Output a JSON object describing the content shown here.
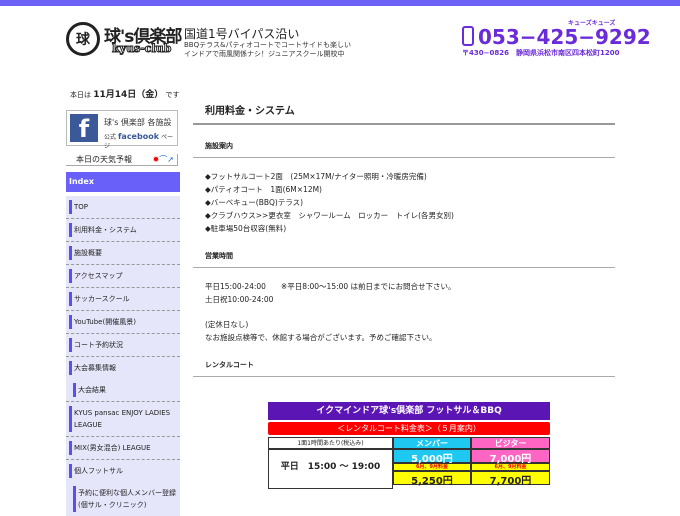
{
  "header": {
    "logo_text": "球",
    "brand": "球's倶楽部",
    "brand_sub": "kyus-club",
    "tagline": "国道1号バイパス沿い",
    "tagline_sub1": "BBQテラス&パティオコートでコートサイドも楽しい",
    "tagline_sub2": "インドアで雨風関係ナシ！ジュニアスクール開校中",
    "phone": "053−425−9292",
    "phone_kana": "キューズキューズ",
    "address": "〒430−0826　静岡県浜松市南区四本松町1200",
    "accent": "#6a2bd8"
  },
  "sidebar": {
    "date_prefix": "本日は",
    "date": "11月14日（金）",
    "date_suffix": "です",
    "facebook": {
      "line1": "球's 倶楽部 各施設",
      "line2_prefix": "公式",
      "line2_brand": "facebook",
      "line2_suffix": "ページ"
    },
    "weather": "本日の天気予報",
    "index_label": "Index",
    "items": [
      {
        "label": "TOP"
      },
      {
        "label": "利用料金・システム"
      },
      {
        "label": "施設概要"
      },
      {
        "label": "アクセスマップ"
      },
      {
        "label": "サッカースクール"
      },
      {
        "label": "YouTube(開催風景)"
      },
      {
        "label": "コート予約状況"
      },
      {
        "label": "大会募集情報"
      },
      {
        "label": "大会結果"
      },
      {
        "label": "KYUS pansac ENJOY LADIES LEAGUE"
      },
      {
        "label": "MIX(男女混合) LEAGUE"
      },
      {
        "label": "個人フットサル"
      },
      {
        "label": "予約に便利な個人メンバー登録(個サル・クリニック)"
      }
    ]
  },
  "main": {
    "title": "利用料金・システム",
    "facility": {
      "heading": "施設案内",
      "lines": [
        "◆フットサルコート2面　(25M×17M/ナイター照明・冷暖房完備)",
        "◆パティオコート　1面(6M×12M)",
        "◆バーベキュー(BBQ)テラス)",
        "◆クラブハウス>>更衣室　シャワールーム　ロッカー　トイレ(各男女別)",
        "◆駐車場50台収容(無料)"
      ]
    },
    "hours": {
      "heading": "営業時間",
      "l1": "平日15:00-24:00　　※平日8:00〜15:00 は前日までにお問合せ下さい。",
      "l2": "土日祝10:00-24:00",
      "l3": "(定休日なし)",
      "l4": "なお施設点検等で、休館する場合がございます。予めご確認下さい。"
    },
    "rental": {
      "heading": "レンタルコート",
      "table_title": "イクマインドア球's倶楽部 フットサル＆BBQ",
      "table_sub": "＜レンタルコート料金表＞（５月案内）",
      "col0": "1面1時間あたり(税込み)",
      "col1": "メンバー",
      "col2": "ビジター",
      "row_label": "平日　15:00 〜 19:00",
      "member_price": "5,000円",
      "visitor_price": "7,000円",
      "note": "6月、9月料金",
      "member_price2": "5,250円",
      "visitor_price2": "7,700円"
    }
  }
}
